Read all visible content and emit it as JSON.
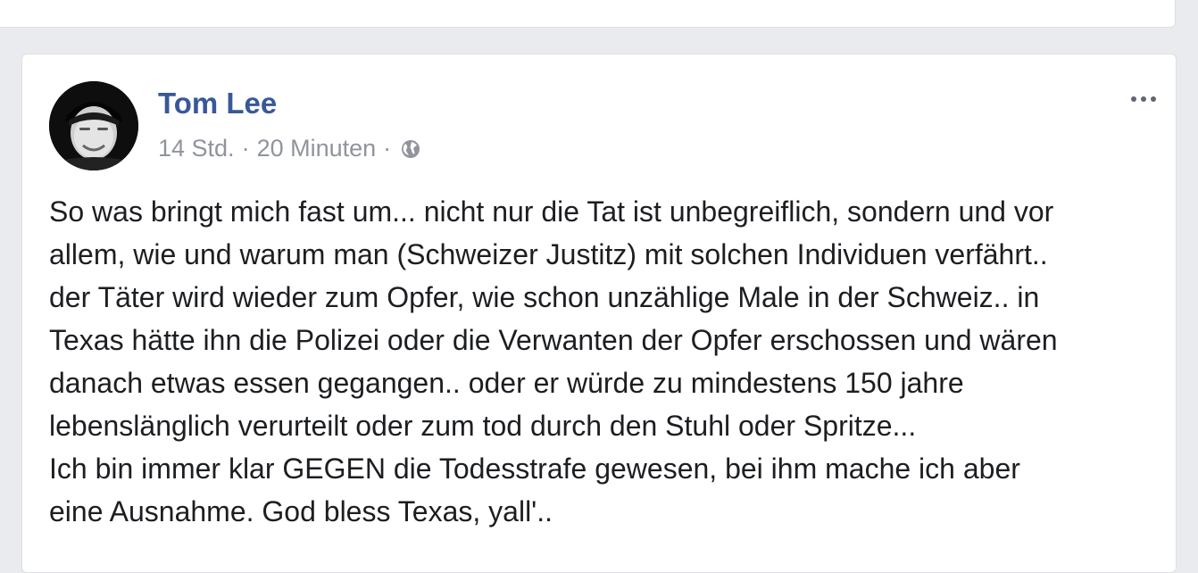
{
  "post": {
    "author": "Tom Lee",
    "time_hours": "14 Std.",
    "separator": "·",
    "time_minutes": "20 Minuten",
    "audience_icon": "globe-icon",
    "more_icon": "ellipsis-icon",
    "text_lines": [
      "So was bringt mich fast um... nicht nur die Tat ist unbegreiflich, sondern und vor",
      "allem, wie und warum man (Schweizer Justitz) mit solchen Individuen verfährt..",
      "der Täter wird wieder zum Opfer, wie schon unzählige Male in der Schweiz.. in",
      "Texas hätte ihn die Polizei oder die Verwanten der Opfer erschossen und wären",
      "danach etwas essen gegangen.. oder er würde zu mindestens 150 jahre",
      "lebenslänglich verurteilt oder zum tod durch den Stuhl oder Spritze...",
      "Ich bin immer klar GEGEN die Todesstrafe gewesen, bei ihm mache ich aber",
      "eine Ausnahme. God bless Texas, yall'.."
    ]
  },
  "colors": {
    "author_link": "#385898",
    "meta_text": "#90949c",
    "body_text": "#1c1e21",
    "page_bg": "#e9ebee",
    "card_bg": "#ffffff"
  }
}
